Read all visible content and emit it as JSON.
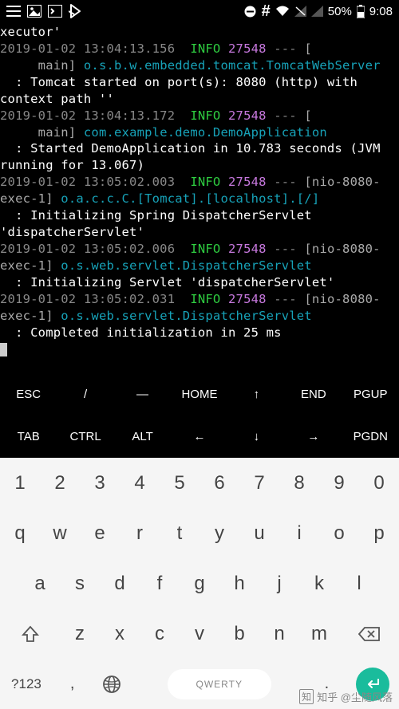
{
  "status": {
    "battery": "50%",
    "time": "9:08"
  },
  "terminal": {
    "l0": "xecutor'",
    "l1_ts": "2019-01-02 13:04:13.156",
    "l1_lvl": "INFO",
    "l1_pid": "27548",
    "l1_dash": "---",
    "l1_thr": "[",
    "l2_thr": "     main]",
    "l2_cls": "o.s.b.w.embedded.tomcat.TomcatWebServer",
    "l3": "  : Tomcat started on port(s): 8080 (http) with context path ''",
    "l4_ts": "2019-01-02 13:04:13.172",
    "l4_lvl": "INFO",
    "l4_pid": "27548",
    "l4_dash": "---",
    "l4_thr": "[",
    "l5_thr": "     main]",
    "l5_cls": "com.example.demo.DemoApplication",
    "l6": "  : Started DemoApplication in 10.783 seconds (JVM running for 13.067)",
    "l7_ts": "2019-01-02 13:05:02.003",
    "l7_lvl": "INFO",
    "l7_pid": "27548",
    "l7_dash": "---",
    "l7_thr": "[nio-8080-exec-1]",
    "l7_cls": "o.a.c.c.C.[Tomcat].[localhost].[/]",
    "l8": "  : Initializing Spring DispatcherServlet 'dispatcherServlet'",
    "l9_ts": "2019-01-02 13:05:02.006",
    "l9_lvl": "INFO",
    "l9_pid": "27548",
    "l9_dash": "---",
    "l9_thr": "[nio-8080-exec-1]",
    "l9_cls": "o.s.web.servlet.DispatcherServlet",
    "l10": "  : Initializing Servlet 'dispatcherServlet'",
    "l11_ts": "2019-01-02 13:05:02.031",
    "l11_lvl": "INFO",
    "l11_pid": "27548",
    "l11_dash": "---",
    "l11_thr": "[nio-8080-exec-1]",
    "l11_cls": "o.s.web.servlet.DispatcherServlet",
    "l12": "  : Completed initialization in 25 ms"
  },
  "extra_keys": {
    "row1": [
      "ESC",
      "/",
      "—",
      "HOME",
      "↑",
      "END",
      "PGUP"
    ],
    "row2": [
      "TAB",
      "CTRL",
      "ALT",
      "←",
      "↓",
      "→",
      "PGDN"
    ]
  },
  "keyboard": {
    "nums": [
      "1",
      "2",
      "3",
      "4",
      "5",
      "6",
      "7",
      "8",
      "9",
      "0"
    ],
    "row1": [
      "q",
      "w",
      "e",
      "r",
      "t",
      "y",
      "u",
      "i",
      "o",
      "p"
    ],
    "row2": [
      "a",
      "s",
      "d",
      "f",
      "g",
      "h",
      "j",
      "k",
      "l"
    ],
    "row3": [
      "z",
      "x",
      "c",
      "v",
      "b",
      "n",
      "m"
    ],
    "sym": "?123",
    "comma": ",",
    "period": ".",
    "space_label": "QWERTY"
  },
  "watermark": "知乎 @尘随风落"
}
